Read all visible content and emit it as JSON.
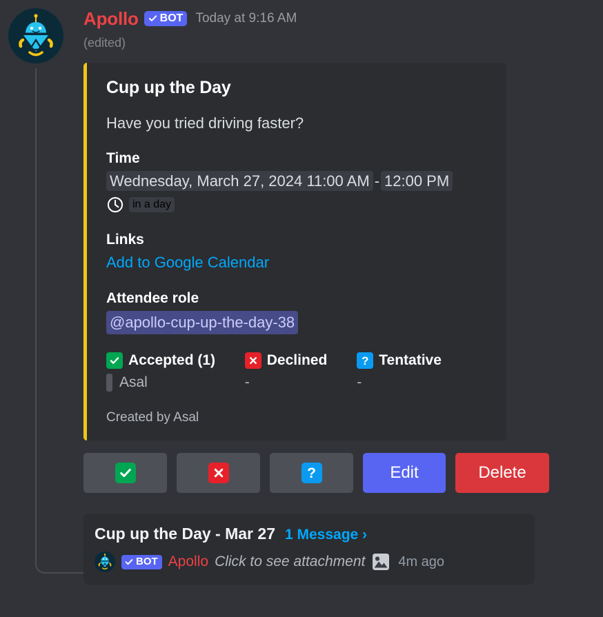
{
  "message": {
    "author": "Apollo",
    "bot_badge": "BOT",
    "timestamp": "Today at 9:16 AM",
    "edited": "(edited)",
    "avatar_icon": "apollo-robot-logo"
  },
  "embed": {
    "accent_color": "#f0c419",
    "title": "Cup up the Day",
    "description": "Have you tried driving faster?",
    "fields": {
      "time": {
        "name": "Time",
        "start": "Wednesday, March 27, 2024 11:00 AM",
        "separator": "-",
        "end": "12:00 PM",
        "clock_icon": "clock-icon",
        "relative": "in a day"
      },
      "links": {
        "name": "Links",
        "link_label": "Add to Google Calendar"
      },
      "attendee_role": {
        "name": "Attendee role",
        "mention": "@apollo-cup-up-the-day-38"
      }
    },
    "rsvp": [
      {
        "label": "Accepted (1)",
        "icon": "white-check-mark-emoji",
        "icon_color": "#00a652",
        "glyph": "check",
        "members": [
          "Asal"
        ],
        "empty_text": ""
      },
      {
        "label": "Declined",
        "icon": "cross-mark-emoji",
        "icon_color": "#e62129",
        "glyph": "cross",
        "members": [],
        "empty_text": "-"
      },
      {
        "label": "Tentative",
        "icon": "question-mark-emoji",
        "icon_color": "#0a9bf1",
        "glyph": "question",
        "members": [],
        "empty_text": "-"
      }
    ],
    "footer": "Created by Asal"
  },
  "buttons": [
    {
      "name": "accept",
      "glyph": "check",
      "label": "",
      "style": "secondary",
      "icon_color": "#00a652"
    },
    {
      "name": "decline",
      "glyph": "cross",
      "label": "",
      "style": "secondary",
      "icon_color": "#e62129"
    },
    {
      "name": "tentative",
      "glyph": "question",
      "label": "",
      "style": "secondary",
      "icon_color": "#0a9bf1"
    },
    {
      "name": "edit",
      "glyph": "",
      "label": "Edit",
      "style": "primary",
      "icon_color": "#5865f2"
    },
    {
      "name": "delete",
      "glyph": "",
      "label": "Delete",
      "style": "danger",
      "icon_color": "#da373c"
    }
  ],
  "thread": {
    "name": "Cup up the Day - Mar 27",
    "message_count": "1 Message ›",
    "author": "Apollo",
    "bot_badge": "BOT",
    "preview_text": "Click to see attachment",
    "attachment_icon": "picture-icon",
    "time": "4m ago"
  }
}
